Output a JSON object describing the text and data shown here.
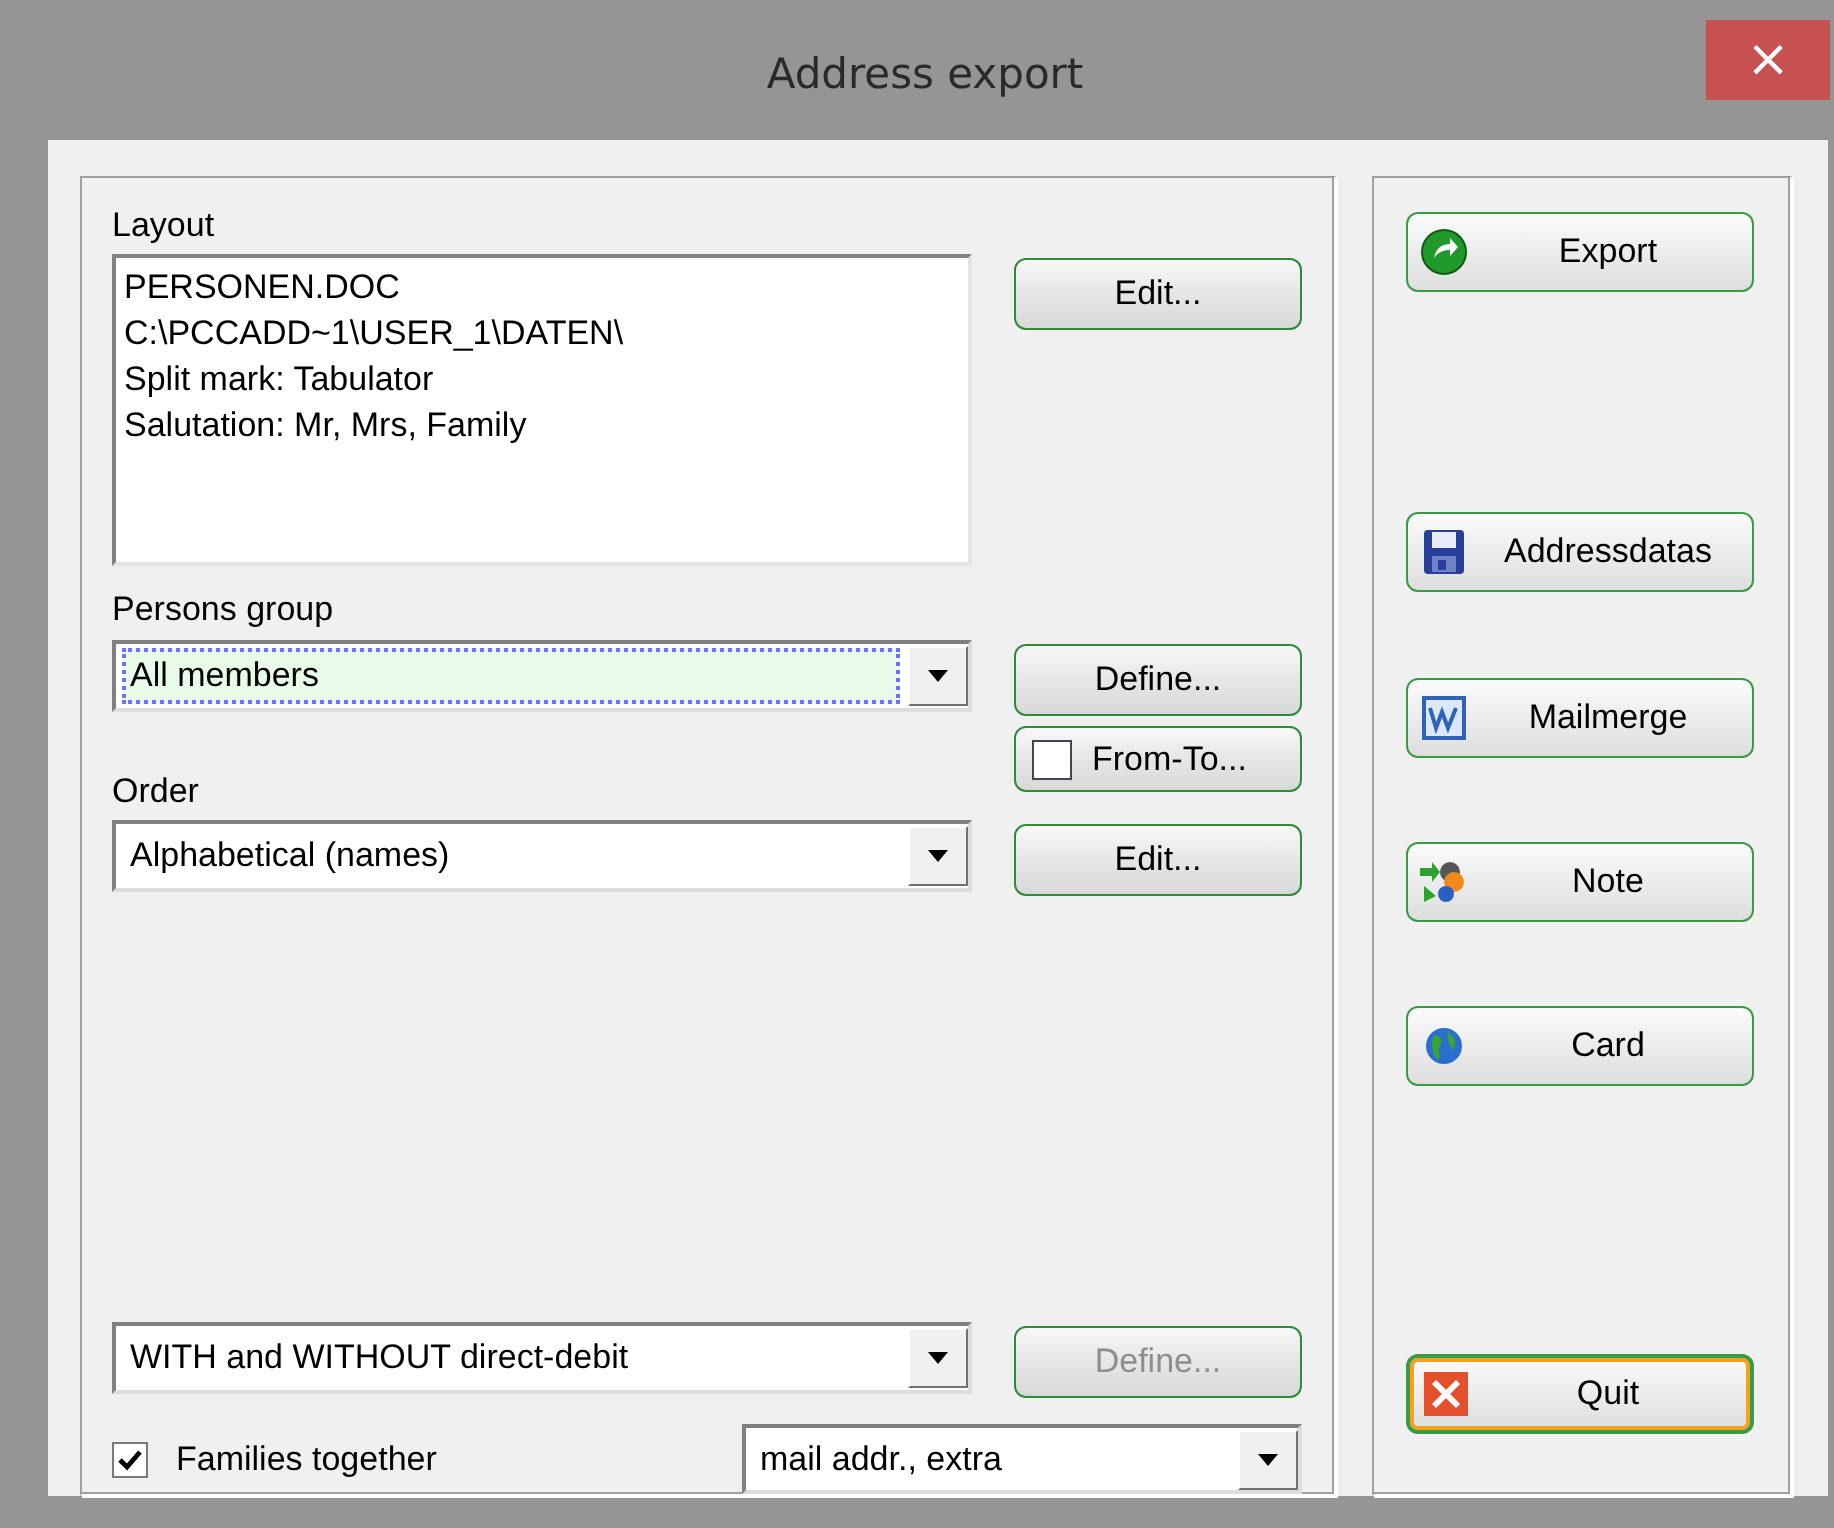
{
  "window": {
    "title": "Address export",
    "close": "×"
  },
  "layout": {
    "label": "Layout",
    "lines": [
      "PERSONEN.DOC",
      "C:\\PCCADD~1\\USER_1\\DATEN\\",
      "Split mark: Tabulator",
      "Salutation: Mr, Mrs, Family"
    ],
    "button": {
      "label": "Edit...",
      "disabled": false
    }
  },
  "persons_group": {
    "label": "Persons group",
    "value": "All members",
    "focused": true,
    "button": {
      "label": "Define...",
      "disabled": false
    },
    "range": {
      "label": "From-To...",
      "checked": false
    }
  },
  "order": {
    "label": "Order",
    "value": "Alphabetical (names)",
    "focused": false,
    "button": {
      "label": "Edit...",
      "disabled": false
    }
  },
  "direct_debit": {
    "value": "WITH and WITHOUT direct-debit",
    "focused": false,
    "button": {
      "label": "Define...",
      "disabled": true
    }
  },
  "families_together": {
    "label": "Families together",
    "checked": true
  },
  "address_type": {
    "value": "mail addr., extra",
    "focused": false
  },
  "actions": [
    {
      "label": "Export",
      "default": false
    },
    {
      "label": "Addressdatas",
      "default": false
    },
    {
      "label": "Mailmerge",
      "default": false
    },
    {
      "label": "Note",
      "default": false
    },
    {
      "label": "Card",
      "default": false
    },
    {
      "label": "Quit",
      "default": true
    }
  ]
}
